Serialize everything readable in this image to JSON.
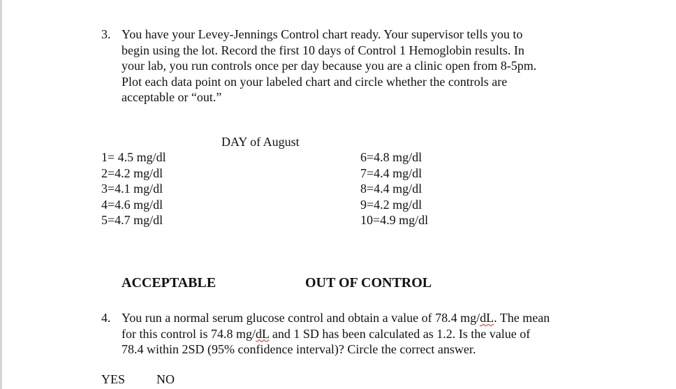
{
  "question3": {
    "number": "3.",
    "lines": [
      "You have your Levey-Jennings Control chart ready.  Your supervisor tells you to",
      "begin using the lot.  Record the first 10 days of Control 1 Hemoglobin results.  In",
      "your lab, you run controls once per day because you are a clinic open from 8-5pm.",
      "Plot each data point on your labeled chart and circle whether the controls are",
      "acceptable or “out.”"
    ],
    "table_title": "DAY of August",
    "left_column": [
      "1= 4.5 mg/dl",
      "2=4.2 mg/dl",
      "3=4.1 mg/dl",
      "4=4.6 mg/dl",
      "5=4.7 mg/dl"
    ],
    "right_column": [
      "6=4.8 mg/dl",
      "7=4.4 mg/dl",
      "8=4.4 mg/dl",
      "9=4.2 mg/dl",
      "10=4.9 mg/dl"
    ],
    "options": {
      "acceptable": "ACCEPTABLE",
      "out_of_control": "OUT OF CONTROL"
    }
  },
  "question4": {
    "number": "4.",
    "line1_a": "You run a normal serum glucose control and obtain a value of 78.4 mg/",
    "line1_spell": "dL",
    "line1_b": ".  The mean",
    "line2_a": "for this control is 74.8 mg/",
    "line2_spell": "dL",
    "line2_b": " and 1 SD has been calculated as 1.2.  Is the value of",
    "line3": "78.4 within 2SD (95% confidence interval)?  Circle the correct answer.",
    "answers": {
      "yes": "YES",
      "no": "NO"
    }
  }
}
